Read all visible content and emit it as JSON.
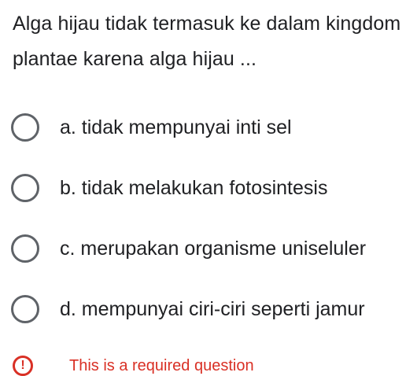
{
  "question": {
    "text": "Alga hijau tidak termasuk ke dalam kingdom plantae karena alga hijau ..."
  },
  "options": [
    {
      "label": "a. tidak mempunyai inti sel"
    },
    {
      "label": "b. tidak melakukan fotosintesis"
    },
    {
      "label": "c. merupakan organisme uniseluler"
    },
    {
      "label": "d. mempunyai ciri-ciri seperti jamur"
    }
  ],
  "validation": {
    "icon": "error-exclamation-icon",
    "icon_glyph": "!",
    "message": "This is a required question",
    "color": "#d93025"
  },
  "colors": {
    "text": "#202124",
    "radio_border": "#5f6368",
    "error": "#d93025"
  }
}
